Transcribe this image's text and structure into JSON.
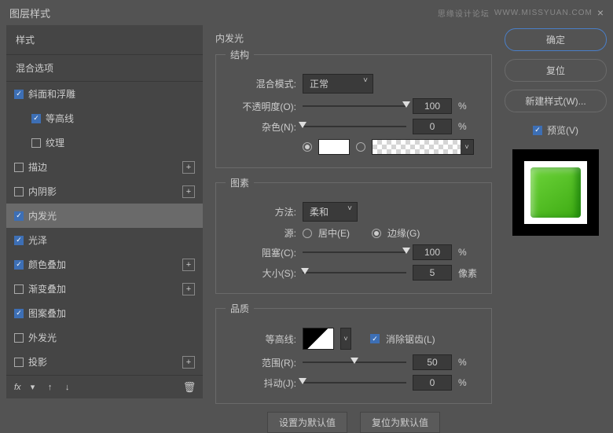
{
  "title": "图层样式",
  "watermark_left": "思缘设计论坛",
  "watermark_right": "WWW.MISSYUAN.COM",
  "left": {
    "header": "样式",
    "blending_options": "混合选项",
    "items": [
      {
        "label": "斜面和浮雕",
        "checked": true,
        "has_add": false,
        "sub": false
      },
      {
        "label": "等高线",
        "checked": true,
        "has_add": false,
        "sub": true
      },
      {
        "label": "纹理",
        "checked": false,
        "has_add": false,
        "sub": true
      },
      {
        "label": "描边",
        "checked": false,
        "has_add": true,
        "sub": false
      },
      {
        "label": "内阴影",
        "checked": false,
        "has_add": true,
        "sub": false
      },
      {
        "label": "内发光",
        "checked": true,
        "has_add": false,
        "sub": false,
        "selected": true
      },
      {
        "label": "光泽",
        "checked": true,
        "has_add": false,
        "sub": false
      },
      {
        "label": "颜色叠加",
        "checked": true,
        "has_add": true,
        "sub": false
      },
      {
        "label": "渐变叠加",
        "checked": false,
        "has_add": true,
        "sub": false
      },
      {
        "label": "图案叠加",
        "checked": true,
        "has_add": false,
        "sub": false
      },
      {
        "label": "外发光",
        "checked": false,
        "has_add": false,
        "sub": false
      },
      {
        "label": "投影",
        "checked": false,
        "has_add": true,
        "sub": false
      }
    ],
    "fx": "fx"
  },
  "center": {
    "main_title": "内发光",
    "structure": {
      "legend": "结构",
      "blend_mode_label": "混合模式:",
      "blend_mode_value": "正常",
      "opacity_label": "不透明度(O):",
      "opacity_value": "100",
      "opacity_unit": "%",
      "noise_label": "杂色(N):",
      "noise_value": "0",
      "noise_unit": "%"
    },
    "elements": {
      "legend": "图素",
      "technique_label": "方法:",
      "technique_value": "柔和",
      "source_label": "源:",
      "source_center": "居中(E)",
      "source_edge": "边缘(G)",
      "choke_label": "阻塞(C):",
      "choke_value": "100",
      "choke_unit": "%",
      "size_label": "大小(S):",
      "size_value": "5",
      "size_unit": "像素"
    },
    "quality": {
      "legend": "品质",
      "contour_label": "等高线:",
      "antialias": "消除锯齿(L)",
      "range_label": "范围(R):",
      "range_value": "50",
      "range_unit": "%",
      "jitter_label": "抖动(J):",
      "jitter_value": "0",
      "jitter_unit": "%"
    },
    "make_default": "设置为默认值",
    "reset_default": "复位为默认值"
  },
  "right": {
    "ok": "确定",
    "cancel": "复位",
    "new_style": "新建样式(W)...",
    "preview": "预览(V)"
  }
}
